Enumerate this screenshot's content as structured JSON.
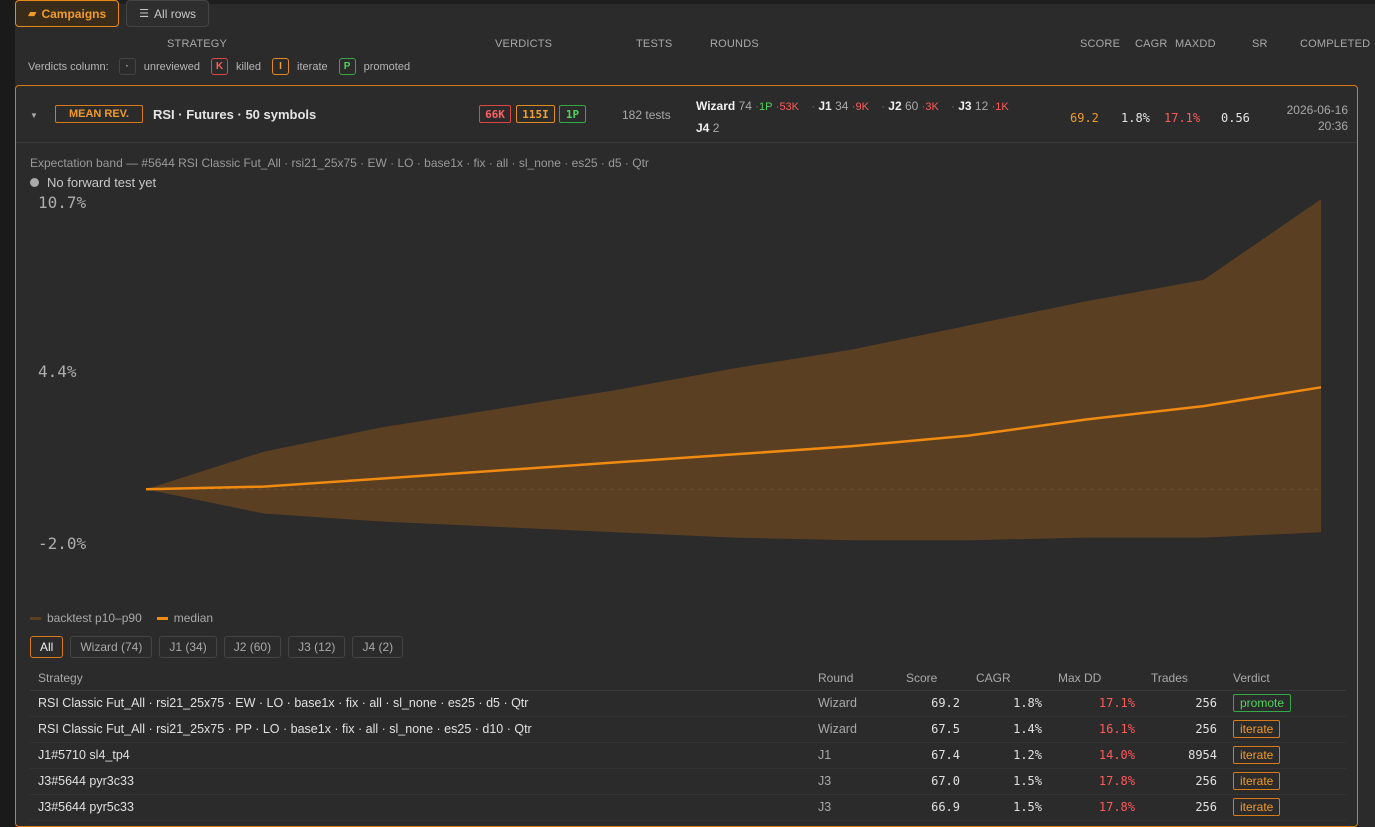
{
  "nav": {
    "campaigns_label": "Campaigns",
    "all_rows_label": "All rows"
  },
  "columns": {
    "strategy": "STRATEGY",
    "verdicts": "VERDICTS",
    "tests": "TESTS",
    "rounds": "ROUNDS",
    "score": "SCORE",
    "cagr": "CAGR",
    "maxdd": "MAXDD",
    "sr": "SR",
    "completed": "COMPLETED"
  },
  "verdict_legend": {
    "label": "Verdicts column:",
    "items": [
      {
        "symbol": "·",
        "text": "unreviewed"
      },
      {
        "symbol": "K",
        "text": "killed"
      },
      {
        "symbol": "I",
        "text": "iterate"
      },
      {
        "symbol": "P",
        "text": "promoted"
      }
    ]
  },
  "campaign": {
    "type_badge": "MEAN REV.",
    "name": "RSI · Futures · 50 symbols",
    "verdict_killed": "66K",
    "verdict_iterate": "115I",
    "verdict_promoted": "1P",
    "tests": "182 tests",
    "rounds": [
      {
        "name": "Wizard",
        "count": "74",
        "promoted": "1P",
        "killed": "53K"
      },
      {
        "name": "J1",
        "count": "34",
        "promoted": "",
        "killed": "9K"
      },
      {
        "name": "J2",
        "count": "60",
        "promoted": "",
        "killed": "3K"
      },
      {
        "name": "J3",
        "count": "12",
        "promoted": "",
        "killed": "1K"
      },
      {
        "name": "J4",
        "count": "2",
        "promoted": "",
        "killed": ""
      }
    ],
    "score": "69.2",
    "cagr": "1.8%",
    "maxdd": "17.1%",
    "sr": "0.56",
    "completed_date": "2026-06-16",
    "completed_time": "20:36"
  },
  "band": {
    "title": "Expectation band — #5644 RSI Classic Fut_All · rsi21_25x75 · EW · LO · base1x · fix · all · sl_none · es25 · d5 · Qtr",
    "status": "No forward test yet"
  },
  "chart_data": {
    "type": "area",
    "y_ticks": [
      "10.7%",
      "4.4%",
      "-2.0%"
    ],
    "ylim": [
      -2.0,
      10.7
    ],
    "x": [
      0,
      0.1,
      0.2,
      0.3,
      0.4,
      0.5,
      0.6,
      0.7,
      0.8,
      0.9,
      1.0
    ],
    "series": [
      {
        "name": "backtest p10–p90",
        "lower": [
          0,
          -0.9,
          -1.2,
          -1.4,
          -1.6,
          -1.8,
          -1.9,
          -1.9,
          -1.8,
          -1.8,
          -1.6
        ],
        "upper": [
          0,
          1.4,
          2.3,
          3.0,
          3.7,
          4.5,
          5.2,
          6.1,
          7.0,
          7.8,
          10.8
        ],
        "color": "#5b3f22"
      },
      {
        "name": "median",
        "values": [
          0,
          0.1,
          0.4,
          0.7,
          1.0,
          1.3,
          1.6,
          2.0,
          2.6,
          3.1,
          3.8
        ],
        "color": "#f08a10"
      }
    ],
    "legend": [
      "backtest p10–p90",
      "median"
    ],
    "grid": false
  },
  "filters": [
    "All",
    "Wizard (74)",
    "J1 (34)",
    "J2 (60)",
    "J3 (12)",
    "J4 (2)"
  ],
  "table": {
    "headers": [
      "Strategy",
      "Round",
      "Score",
      "CAGR",
      "Max DD",
      "Trades",
      "Verdict"
    ],
    "rows": [
      [
        "RSI Classic Fut_All · rsi21_25x75 · EW · LO · base1x · fix · all · sl_none · es25 · d5 · Qtr",
        "Wizard",
        "69.2",
        "1.8%",
        "17.1%",
        "256",
        "promote"
      ],
      [
        "RSI Classic Fut_All · rsi21_25x75 · PP · LO · base1x · fix · all · sl_none · es25 · d10 · Qtr",
        "Wizard",
        "67.5",
        "1.4%",
        "16.1%",
        "256",
        "iterate"
      ],
      [
        "J1#5710 sl4_tp4",
        "J1",
        "67.4",
        "1.2%",
        "14.0%",
        "8954",
        "iterate"
      ],
      [
        "J3#5644 pyr3c33",
        "J3",
        "67.0",
        "1.5%",
        "17.8%",
        "256",
        "iterate"
      ],
      [
        "J3#5644 pyr5c33",
        "J3",
        "66.9",
        "1.5%",
        "17.8%",
        "256",
        "iterate"
      ]
    ]
  },
  "colors": {
    "accent": "#e88a1a",
    "killed": "#ff5a5a",
    "promoted": "#4cd45c",
    "band": "#5b3f22",
    "median": "#f08a10"
  }
}
